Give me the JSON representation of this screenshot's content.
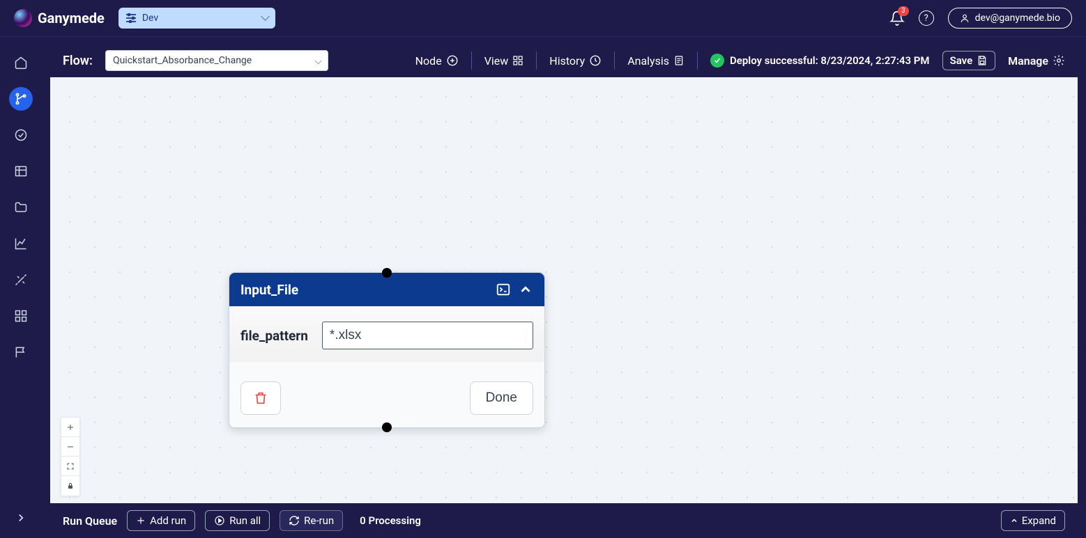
{
  "topbar": {
    "brand": "Ganymede",
    "env": "Dev",
    "notif_count": "3",
    "user_email": "dev@ganymede.bio"
  },
  "flowbar": {
    "flow_label": "Flow:",
    "flow_name": "Quickstart_Absorbance_Change",
    "node_label": "Node",
    "view_label": "View",
    "history_label": "History",
    "analysis_label": "Analysis",
    "status_text": "Deploy successful: 8/23/2024, 2:27:43 PM",
    "save_label": "Save",
    "manage_label": "Manage"
  },
  "node": {
    "title": "Input_File",
    "param_label": "file_pattern",
    "param_value": "*.xlsx",
    "done_label": "Done"
  },
  "bottombar": {
    "run_queue_label": "Run Queue",
    "add_run_label": "Add run",
    "run_all_label": "Run all",
    "rerun_label": "Re-run",
    "processing_label": "0 Processing",
    "expand_label": "Expand"
  }
}
